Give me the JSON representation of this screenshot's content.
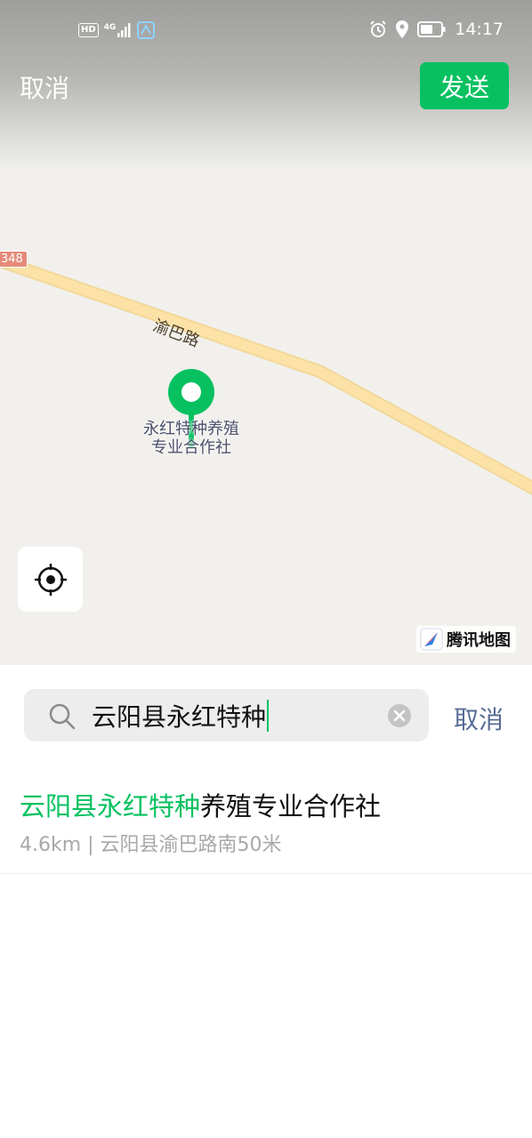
{
  "status_bar": {
    "hd": "HD",
    "network": "4G",
    "time": "14:17"
  },
  "header": {
    "cancel_label": "取消",
    "send_label": "发送"
  },
  "map": {
    "route_badge": "348",
    "road_name": "渝巴路",
    "poi_label_line1": "永红特种养殖",
    "poi_label_line2": "专业合作社",
    "provider": "腾讯地图",
    "pin_color": "#07c160"
  },
  "search": {
    "query": "云阳县永红特种",
    "cancel_label": "取消"
  },
  "results": [
    {
      "title_match": "云阳县永红特种",
      "title_rest": "养殖专业合作社",
      "subtitle": "4.6km | 云阳县渝巴路南50米"
    }
  ],
  "colors": {
    "accent": "#07c160",
    "link": "#576b95"
  }
}
